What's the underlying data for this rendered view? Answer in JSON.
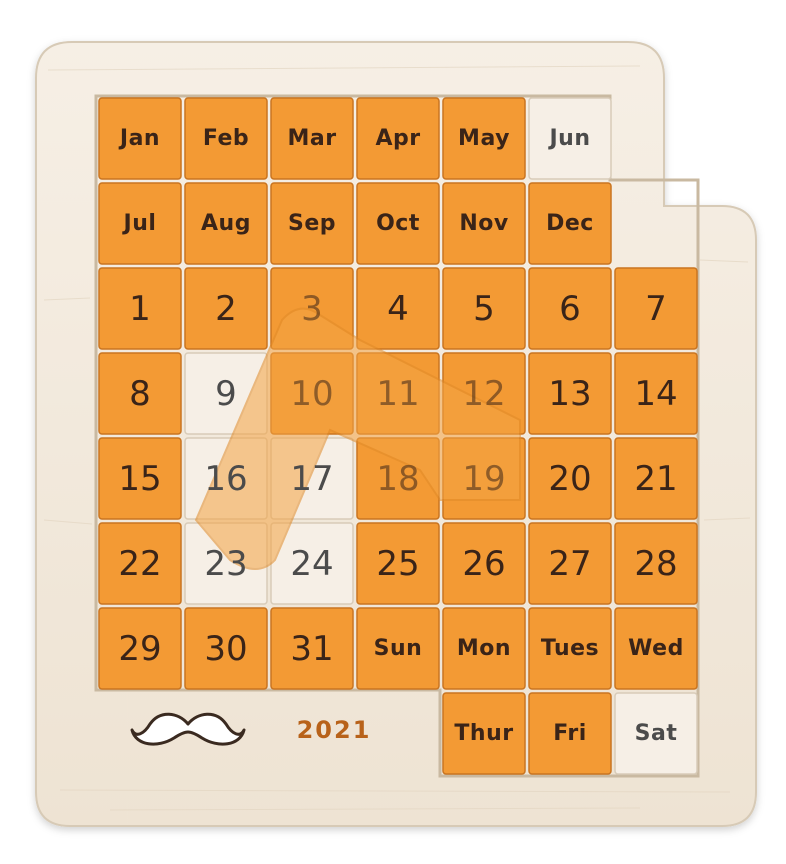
{
  "colors": {
    "wood": "#f3ebe0",
    "wood_edge": "#d9cdbb",
    "orange": "#f39a34",
    "orange_dark": "#c97420",
    "exposed_cell": "#f6efe6",
    "engraving": "#3a2418"
  },
  "months": [
    "Jan",
    "Feb",
    "Mar",
    "Apr",
    "May",
    "Jun",
    "Jul",
    "Aug",
    "Sep",
    "Oct",
    "Nov",
    "Dec"
  ],
  "days": [
    "1",
    "2",
    "3",
    "4",
    "5",
    "6",
    "7",
    "8",
    "9",
    "10",
    "11",
    "12",
    "13",
    "14",
    "15",
    "16",
    "17",
    "18",
    "19",
    "20",
    "21",
    "22",
    "23",
    "24",
    "25",
    "26",
    "27",
    "28",
    "29",
    "30",
    "31"
  ],
  "weekdays": [
    "Sun",
    "Mon",
    "Tues",
    "Wed",
    "Thur",
    "Fri",
    "Sat"
  ],
  "year_plaque": "2021",
  "decoration_icon": "mustache-icon",
  "exposed": [
    "Jun",
    "9",
    "16",
    "17",
    "23",
    "24",
    "Sat"
  ]
}
